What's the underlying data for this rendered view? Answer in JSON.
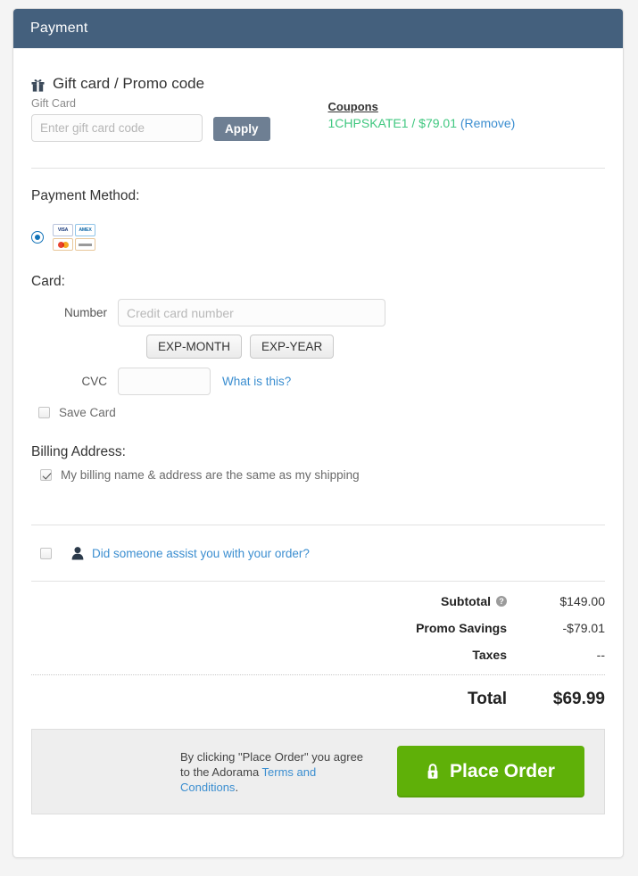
{
  "header": {
    "title": "Payment"
  },
  "giftcard": {
    "heading": "Gift card / Promo code",
    "icon": "gift-icon",
    "field_label": "Gift Card",
    "input_placeholder": "Enter gift card code",
    "input_value": "",
    "apply_label": "Apply"
  },
  "coupons": {
    "title": "Coupons",
    "applied_code": "1CHPSKATE1 / $79.01",
    "remove_label": "(Remove)",
    "code_color": "#3fc77f",
    "link_color": "#3b8ed0"
  },
  "payment_method": {
    "title": "Payment Method:",
    "selected": true,
    "cards": [
      {
        "name": "visa-logo",
        "label": "VISA"
      },
      {
        "name": "amex-logo",
        "label": "AMEX"
      },
      {
        "name": "mastercard-logo",
        "label": ""
      },
      {
        "name": "discover-logo",
        "label": ""
      }
    ]
  },
  "card": {
    "title": "Card:",
    "number_label": "Number",
    "number_placeholder": "Credit card number",
    "number_value": "",
    "exp_month_label": "EXP-MONTH",
    "exp_year_label": "EXP-YEAR",
    "cvc_label": "CVC",
    "cvc_value": "",
    "what_is_this": "What is this?",
    "save_card_label": "Save Card",
    "save_card_checked": false
  },
  "billing": {
    "title": "Billing Address:",
    "same_as_shipping_label": "My billing name & address are the same as my shipping",
    "same_as_shipping_checked": true
  },
  "assist": {
    "label": "Did someone assist you with your order?",
    "checked": false,
    "icon": "person-icon"
  },
  "totals": {
    "rows": [
      {
        "label": "Subtotal",
        "value": "$149.00",
        "has_help": true
      },
      {
        "label": "Promo Savings",
        "value": "-$79.01",
        "has_help": false
      },
      {
        "label": "Taxes",
        "value": "--",
        "has_help": false
      }
    ],
    "help_glyph": "?",
    "grand_label": "Total",
    "grand_value": "$69.99"
  },
  "place_order": {
    "agree_prefix": "By clicking \"Place Order\" you agree to the Adorama ",
    "terms_link": "Terms and Conditions",
    "agree_suffix": ".",
    "button_label": "Place Order",
    "button_color": "#5fb008",
    "lock_icon": "lock-icon"
  }
}
